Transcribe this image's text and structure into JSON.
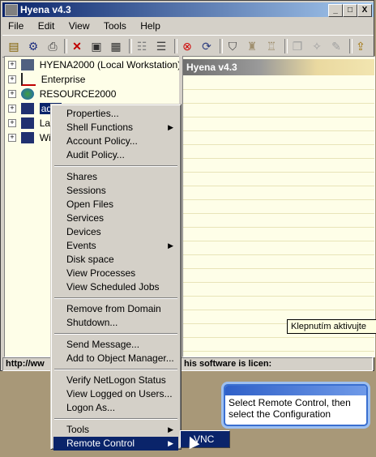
{
  "window": {
    "title": "Hyena v4.3",
    "minimize": "_",
    "maximize": "□",
    "close": "X"
  },
  "menubar": [
    "File",
    "Edit",
    "View",
    "Tools",
    "Help"
  ],
  "tree": [
    {
      "label": "HYENA2000 (Local Workstation)",
      "icon": "computer-icon"
    },
    {
      "label": "Enterprise",
      "icon": "network-icon"
    },
    {
      "label": "RESOURCE2000",
      "icon": "globe-icon"
    },
    {
      "label": "adm",
      "icon": "computer-icon",
      "selected": true
    },
    {
      "label": "Lap",
      "icon": "computer-icon"
    },
    {
      "label": "Wi",
      "icon": "computer-icon"
    }
  ],
  "right_panel": {
    "title": "Hyena v4.3"
  },
  "status": {
    "left": "http://ww",
    "right": "his software is licen:"
  },
  "tooltip": "Klepnutím aktivujte",
  "context_menu": {
    "groups": [
      [
        "Properties...",
        "Shell Functions",
        "Account Policy...",
        "Audit Policy..."
      ],
      [
        "Shares",
        "Sessions",
        "Open Files",
        "Services",
        "Devices",
        "Events",
        "Disk space",
        "View Processes",
        "View Scheduled Jobs"
      ],
      [
        "Remove from Domain",
        "Shutdown..."
      ],
      [
        "Send Message...",
        "Add to Object Manager..."
      ],
      [
        "Verify NetLogon Status",
        "View Logged on Users...",
        "Logon As..."
      ],
      [
        "Tools",
        "Remote Control"
      ]
    ]
  },
  "submenu": {
    "item": "VNC"
  },
  "callout": {
    "text": "Select Remote Control, then select the Configuration"
  },
  "colors": {
    "highlight": "#0a246a",
    "tree_bg": "#fefee8",
    "callout_border": "#3a6fd0"
  }
}
